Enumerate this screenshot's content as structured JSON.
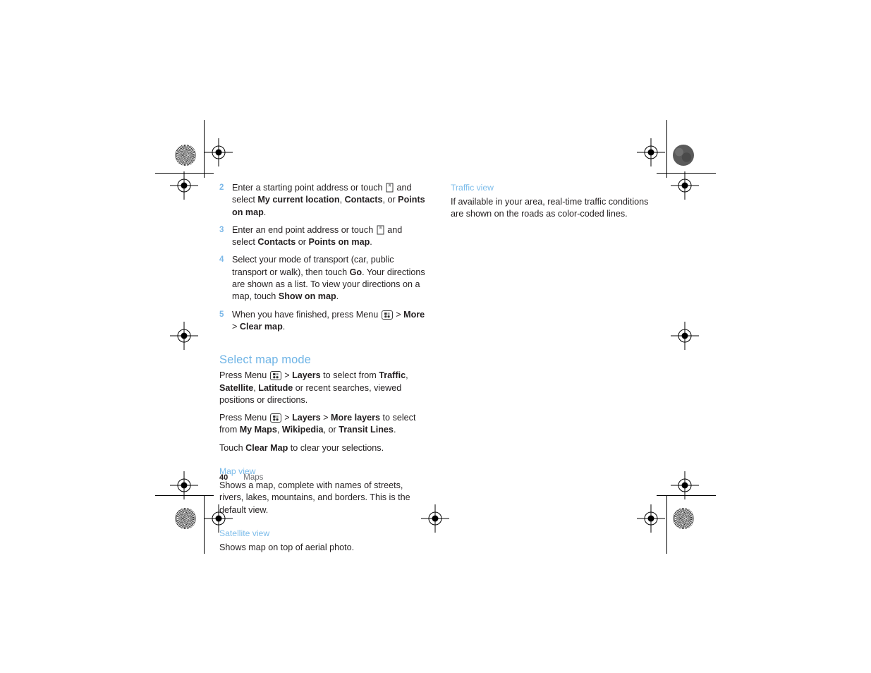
{
  "page": {
    "number": "40",
    "chapter": "Maps"
  },
  "colors": {
    "heading": "#6fb4e6",
    "subheading": "#7cbcea",
    "step_number": "#7cb8e8",
    "body_text": "#231f20",
    "footer_chapter": "#6d6e71"
  },
  "icons": {
    "map_pin": "map-pin-key-icon",
    "menu_key": "menu-key-icon"
  },
  "left_column": {
    "steps": [
      {
        "number": "2",
        "parts": [
          {
            "t": "Enter a starting point address or touch ",
            "b": false
          },
          {
            "t": "ICON:map_pin",
            "b": false
          },
          {
            "t": " and select ",
            "b": false
          },
          {
            "t": "My current location",
            "b": true
          },
          {
            "t": ", ",
            "b": false
          },
          {
            "t": "Contacts",
            "b": true
          },
          {
            "t": ", or ",
            "b": false
          },
          {
            "t": "Points on map",
            "b": true
          },
          {
            "t": ".",
            "b": false
          }
        ]
      },
      {
        "number": "3",
        "parts": [
          {
            "t": "Enter an end point address or touch ",
            "b": false
          },
          {
            "t": "ICON:map_pin",
            "b": false
          },
          {
            "t": " and select ",
            "b": false
          },
          {
            "t": "Contacts",
            "b": true
          },
          {
            "t": " or ",
            "b": false
          },
          {
            "t": "Points on map",
            "b": true
          },
          {
            "t": ".",
            "b": false
          }
        ]
      },
      {
        "number": "4",
        "parts": [
          {
            "t": "Select your mode of transport (car, public transport or walk), then touch ",
            "b": false
          },
          {
            "t": "Go",
            "b": true
          },
          {
            "t": ". Your directions are shown as a list. To view your directions on a map, touch ",
            "b": false
          },
          {
            "t": "Show on map",
            "b": true
          },
          {
            "t": ".",
            "b": false
          }
        ]
      },
      {
        "number": "5",
        "parts": [
          {
            "t": "When you have finished, press Menu ",
            "b": false
          },
          {
            "t": "ICON:menu_key",
            "b": false
          },
          {
            "t": " > ",
            "b": false
          },
          {
            "t": "More",
            "b": true
          },
          {
            "t": " > ",
            "b": false
          },
          {
            "t": "Clear map",
            "b": true
          },
          {
            "t": ".",
            "b": false
          }
        ]
      }
    ],
    "section_heading": "Select map mode",
    "paragraphs": [
      [
        {
          "t": "Press Menu ",
          "b": false
        },
        {
          "t": "ICON:menu_key",
          "b": false
        },
        {
          "t": " > ",
          "b": false
        },
        {
          "t": "Layers",
          "b": true
        },
        {
          "t": " to select from ",
          "b": false
        },
        {
          "t": "Traffic",
          "b": true
        },
        {
          "t": ", ",
          "b": false
        },
        {
          "t": "Satellite",
          "b": true
        },
        {
          "t": ", ",
          "b": false
        },
        {
          "t": "Latitude",
          "b": true
        },
        {
          "t": " or recent searches, viewed positions or directions.",
          "b": false
        }
      ],
      [
        {
          "t": "Press Menu ",
          "b": false
        },
        {
          "t": "ICON:menu_key",
          "b": false
        },
        {
          "t": " > ",
          "b": false
        },
        {
          "t": "Layers",
          "b": true
        },
        {
          "t": " > ",
          "b": false
        },
        {
          "t": "More layers",
          "b": true
        },
        {
          "t": " to select from ",
          "b": false
        },
        {
          "t": "My Maps",
          "b": true
        },
        {
          "t": ", ",
          "b": false
        },
        {
          "t": "Wikipedia",
          "b": true
        },
        {
          "t": ", or ",
          "b": false
        },
        {
          "t": "Transit Lines",
          "b": true
        },
        {
          "t": ".",
          "b": false
        }
      ],
      [
        {
          "t": "Touch ",
          "b": false
        },
        {
          "t": "Clear Map",
          "b": true
        },
        {
          "t": " to clear your selections.",
          "b": false
        }
      ]
    ],
    "subsections": [
      {
        "heading": "Map view",
        "body": "Shows a map, complete with names of streets, rivers, lakes, mountains, and borders. This is the default view."
      },
      {
        "heading": "Satellite view",
        "body": "Shows map on top of aerial photo."
      }
    ]
  },
  "right_column": {
    "subsections": [
      {
        "heading": "Traffic view",
        "body": "If available in your area, real-time traffic conditions are shown on the roads as color-coded lines."
      }
    ]
  }
}
